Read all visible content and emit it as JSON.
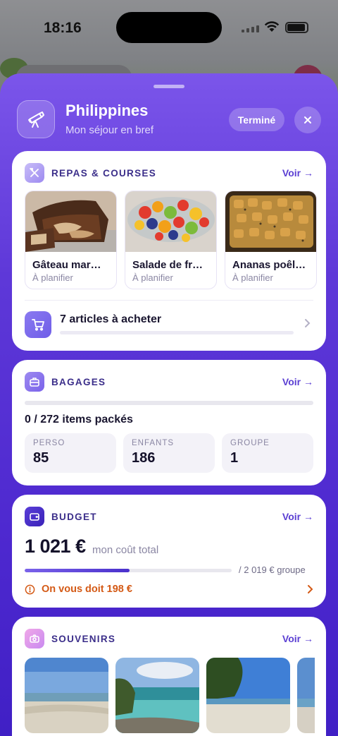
{
  "status_bar": {
    "time": "18:16"
  },
  "header": {
    "title": "Philippines",
    "subtitle": "Mon séjour en bref",
    "done_label": "Terminé",
    "close_symbol": "✕"
  },
  "meals_card": {
    "title": "REPAS & COURSES",
    "see_label": "Voir →",
    "meals": [
      {
        "name": "Gâteau mar…",
        "status": "À planifier"
      },
      {
        "name": "Salade de fr…",
        "status": "À planifier"
      },
      {
        "name": "Ananas poêl…",
        "status": "À planifier"
      }
    ],
    "shopping_label": "7 articles à acheter"
  },
  "bagages_card": {
    "title": "BAGAGES",
    "see_label": "Voir →",
    "packed_label": "0 / 272 items packés",
    "packed_fraction": 0,
    "tiles": [
      {
        "label": "PERSO",
        "value": "85"
      },
      {
        "label": "ENFANTS",
        "value": "186"
      },
      {
        "label": "GROUPE",
        "value": "1"
      }
    ]
  },
  "budget_card": {
    "title": "BUDGET",
    "see_label": "Voir →",
    "amount": "1 021 €",
    "amount_caption": "mon coût total",
    "group_total": "/ 2 019 € groupe",
    "share_fraction": 0.506,
    "owed_label": "On vous doit 198 €"
  },
  "souvenirs_card": {
    "title": "SOUVENIRS",
    "see_label": "Voir →"
  },
  "colors": {
    "accent": "#5b3fd3",
    "sheet_top": "#7b55ea",
    "sheet_bottom": "#3f1fc4",
    "warning": "#d45a16"
  },
  "icons": [
    "telescope-icon",
    "close-icon",
    "utensils-icon",
    "cart-icon",
    "chevron-right-icon",
    "suitcase-icon",
    "wallet-icon",
    "alert-circle-icon",
    "camera-icon"
  ]
}
